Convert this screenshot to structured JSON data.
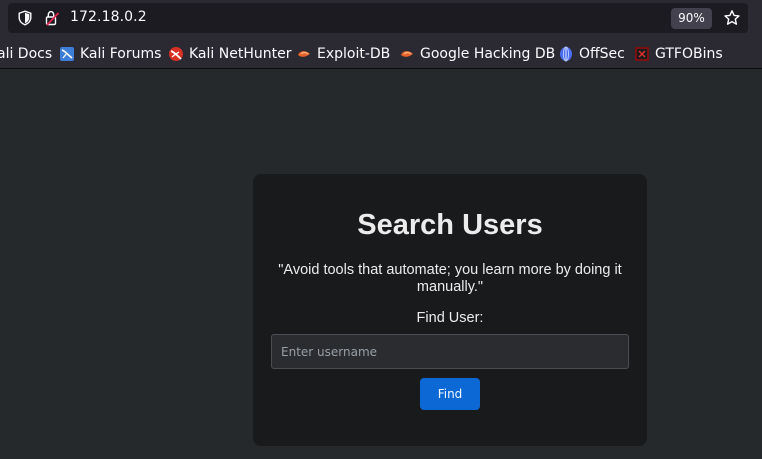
{
  "browser": {
    "url": "172.18.0.2",
    "zoom": "90%",
    "icons": [
      "shield-icon",
      "lock-warning-icon",
      "star-icon"
    ]
  },
  "bookmarks": [
    {
      "label": "ali Docs",
      "icon": "none"
    },
    {
      "label": "Kali Forums",
      "icon": "kali-forums-icon"
    },
    {
      "label": "Kali NetHunter",
      "icon": "kali-nethunter-icon"
    },
    {
      "label": "Exploit-DB",
      "icon": "exploit-db-icon"
    },
    {
      "label": "Google Hacking DB",
      "icon": "ghdb-icon"
    },
    {
      "label": "OffSec",
      "icon": "offsec-icon"
    },
    {
      "label": "GTFOBins",
      "icon": "gtfobins-icon"
    }
  ],
  "page": {
    "heading": "Search Users",
    "quote": "\"Avoid tools that automate; you learn more by doing it manually.\"",
    "find_label": "Find User:",
    "input_placeholder": "Enter username",
    "input_value": "",
    "button_label": "Find"
  },
  "colors": {
    "background": "#25292c",
    "card": "#191a1c",
    "button": "#0b68d4"
  }
}
